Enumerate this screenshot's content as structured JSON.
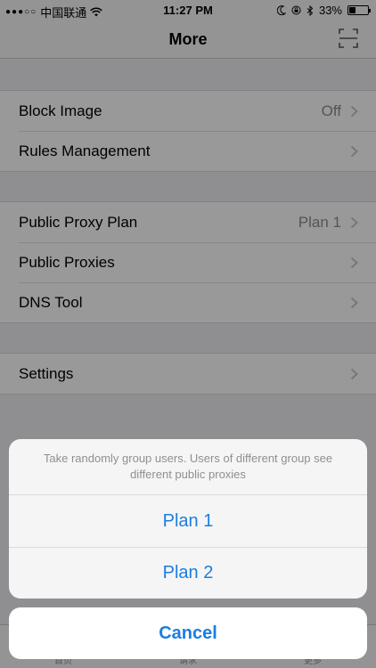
{
  "status_bar": {
    "carrier": "中国联通",
    "signal": "●●●○○",
    "time": "11:27 PM",
    "battery": "33%",
    "battery_level": 0.33
  },
  "nav": {
    "title": "More",
    "scan_icon": "scan-icon"
  },
  "sections": [
    [
      {
        "label": "Block Image",
        "value": "Off"
      },
      {
        "label": "Rules Management",
        "value": ""
      }
    ],
    [
      {
        "label": "Public Proxy Plan",
        "value": "Plan 1"
      },
      {
        "label": "Public Proxies",
        "value": ""
      },
      {
        "label": "DNS Tool",
        "value": ""
      }
    ],
    [
      {
        "label": "Settings",
        "value": ""
      }
    ]
  ],
  "tab_bar": {
    "items": [
      "首页",
      "请求",
      "更多"
    ]
  },
  "action_sheet": {
    "message": "Take randomly group users. Users of different group see different public proxies",
    "options": [
      "Plan 1",
      "Plan 2"
    ],
    "cancel": "Cancel",
    "accent_color": "#1a7ee0"
  }
}
